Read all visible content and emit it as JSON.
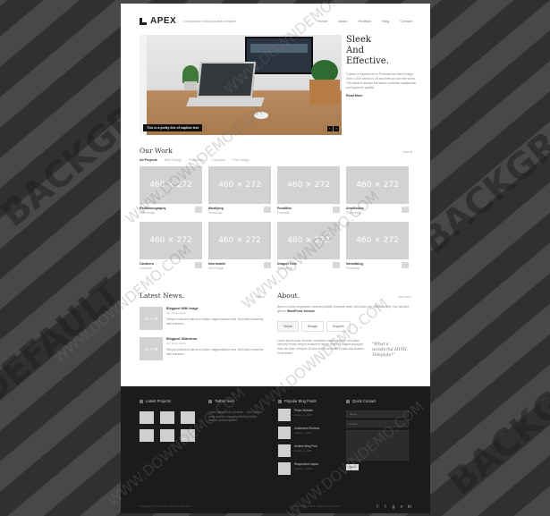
{
  "background_words": [
    "BACKGROUND",
    "DEFAULT",
    "BACKGROUND"
  ],
  "watermark": "WWW.DOWNDEMO.COM",
  "header": {
    "logo": "APEX",
    "tagline": "a responsive minimal portfolio template",
    "nav": [
      "Home",
      "About",
      "Portfolio",
      "Blog",
      "Contact"
    ]
  },
  "hero": {
    "caption": "This is a pretty line of caption text",
    "title_lines": [
      "Sleek",
      "And",
      "Effective."
    ],
    "body": "9 years of experience in Professional Web Design. Over 1,000 clients in 24 countries all over the world. The result is always the same: customer satisfaction and supreme quality!",
    "link": "Read More",
    "controls": [
      "‹",
      "›"
    ]
  },
  "work": {
    "title": "Our Work",
    "more": "view all",
    "filters": [
      "All Projects",
      "Web Design",
      "Photoshop",
      "Concepts",
      "Print Design"
    ],
    "active_filter": 0,
    "items": [
      {
        "thumb": "460 × 272",
        "title": "Redthemography",
        "cat": "Web Design"
      },
      {
        "thumb": "460 × 272",
        "title": "Mostlying",
        "cat": "Photoshop"
      },
      {
        "thumb": "460 × 272",
        "title": "Punditise",
        "cat": "Concepts"
      },
      {
        "thumb": "460 × 272",
        "title": "Amsterdam",
        "cat": "Print Design"
      },
      {
        "thumb": "460 × 272",
        "title": "Canberra",
        "cat": "Concepts"
      },
      {
        "thumb": "460 × 272",
        "title": "Intermobile",
        "cat": "Web Design"
      },
      {
        "thumb": "460 × 272",
        "title": "Dragon Foxe",
        "cat": "Web Design"
      },
      {
        "thumb": "460 × 272",
        "title": "Nemotblog",
        "cat": "Photoshop"
      }
    ]
  },
  "news": {
    "title": "Latest News.",
    "more": "view all",
    "posts": [
      {
        "thumb": "75 × 75",
        "title": "Blogpost With Image",
        "date": "Jan 19 by Admin",
        "body": "Tempor incidunt ut labore et dolore magna aliquam erat. Sed diam nonummy nibh euismod..."
      },
      {
        "thumb": "75 × 75",
        "title": "Blogpost Slideshow",
        "date": "Jan 19 by Admin",
        "body": "Tempor incidunt ut labore et dolore magna aliquam erat. Sed diam nonummy nibh euismod..."
      }
    ]
  },
  "about": {
    "title": "About.",
    "more": "read more",
    "body_lead": "Apex is a fully responsive minimal portfolio template which will show your clients clearly. You can also get the",
    "body_strong": "WordPress Version!",
    "tabs": [
      "Vision",
      "Design",
      "Support"
    ],
    "active_tab": 0,
    "lower": "Lorem ipsum dolor sit amet, consetetur sadipscing elitr, sed diam nonumy eirmod tempor invidunt ut labore et dolore magna aliquyam erat, sed diam voluptua. At vero eos et accusam et justo duo dolores et ea rebum.",
    "quote": "\"What a wonderful HTML Template!\""
  },
  "footer": {
    "projects_title": "Latest Projects",
    "twitter_title": "Twitter feed",
    "twitter_body": "Lorem ipsum dolor sit amet ... Just found a great a better engaging html5 portfolio themes and templates!",
    "blog_title": "Popular Blog Posts",
    "blog_posts": [
      {
        "name": "Photo Website",
        "date": "January 1, 2013"
      },
      {
        "name": "Customers Reviews",
        "date": "January 1, 2013"
      },
      {
        "name": "Another Blog Post",
        "date": "January 1, 2013"
      },
      {
        "name": "Responsive Layout",
        "date": "January 1, 2013"
      }
    ],
    "contact_title": "Quick Contact",
    "contact_fields": [
      "Name",
      "Email"
    ],
    "send": "Send",
    "copyright": "Copyright © 2013 Apex. All rights reserved.",
    "credit": "Valid XHTML & CSS. Made by Templates",
    "social": [
      "f",
      "t",
      "g",
      "v",
      "in"
    ]
  }
}
